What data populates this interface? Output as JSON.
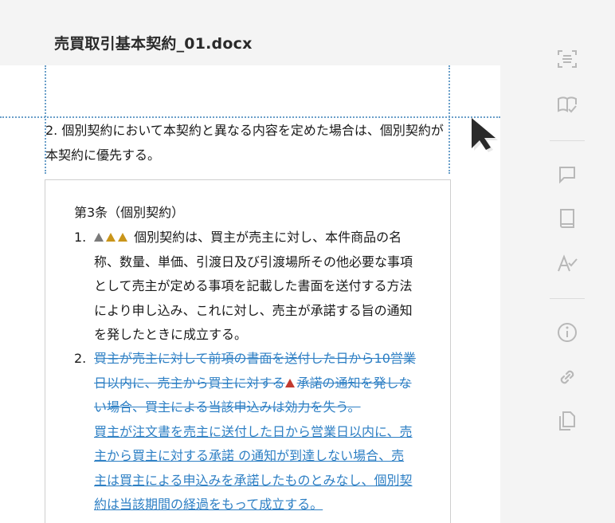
{
  "header": {
    "title": "売買取引基本契約_01.docx"
  },
  "document": {
    "paragraph_2": "2. 個別契約において本契約と異なる内容を定めた場合は、個別契約が本契約に優先する。",
    "clause_heading": "第3条（個別契約）",
    "item1_number": "1.",
    "item1_text": "個別契約は、買主が売主に対し、本件商品の名称、数量、単価、引渡日及び引渡場所その他必要な事項として売主が定める事項を記載した書面を送付する方法 により申し込み、これに対し、売主が承諾する旨の通知を発したときに成立する。",
    "item2_number": "2.",
    "item2_deleted_part1": "買主が売主に対して前項の書面を送付した日から10営業日以内に、売主から買主に対する",
    "item2_deleted_part2": "承諾の通知を発しない場合、買主による当該申込みは効力を失う。",
    "item2_inserted": "買主が注文書を売主に送付した日から営業日以内に、売主から買主に対する承諾 の通知が到達しない場合、売主は買主による申込みを承諾したものとみなし、個別契 約は当該期間の経過をもって成立する。"
  },
  "colors": {
    "guide": "#6a9fc9",
    "revision": "#2d7fc4",
    "warn_gray": "#7a7a7a",
    "warn_yellow": "#c9951a",
    "warn_red": "#c23b2f",
    "icon": "#b8b8b8"
  },
  "rail_icons": [
    "scan-icon",
    "reading-check-icon",
    "comment-icon",
    "book-icon",
    "spell-check-icon",
    "info-icon",
    "link-icon",
    "copy-icon"
  ]
}
